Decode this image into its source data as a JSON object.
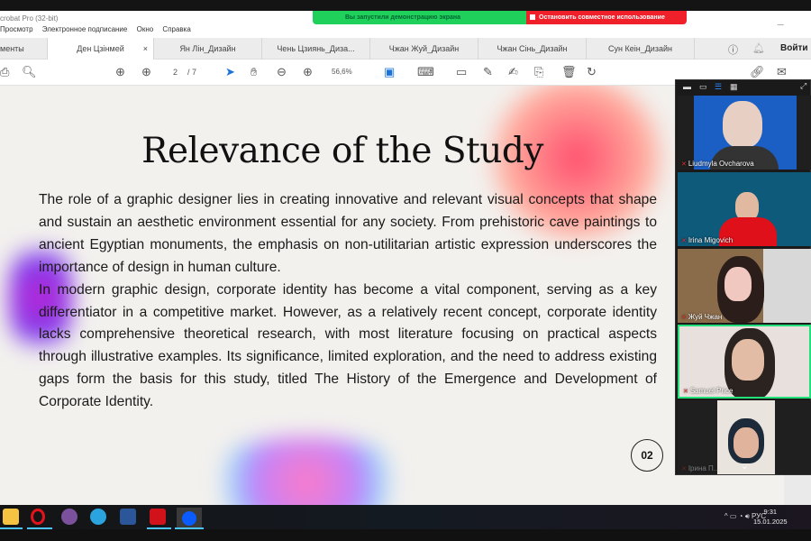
{
  "window": {
    "title": "crobat Pro (32-bit)",
    "share_banner": "Вы запустили демонстрацию экрана",
    "stop_share": "Остановить совместное использование"
  },
  "menu": [
    "Просмотр",
    "Электронное подписание",
    "Окно",
    "Справка"
  ],
  "tabs": [
    {
      "label": "менты"
    },
    {
      "label": "Ден Цзінмей",
      "close": "×"
    },
    {
      "label": "Ян Лін_Дизайн"
    },
    {
      "label": "Чень Цзиянь_Диза..."
    },
    {
      "label": "Чжан Жуй_Дизайн"
    },
    {
      "label": "Чжан Сінь_Дизайн"
    },
    {
      "label": "Сун Кеін_Дизайн"
    }
  ],
  "signin": "Войти",
  "toolbar": {
    "page_current": "2",
    "page_total": "/ 7",
    "zoom": "56,6%"
  },
  "slide": {
    "title": "Relevance of the Study",
    "paragraphs": [
      "The role of a graphic designer lies in creating innovative and relevant visual concepts that shape and sustain an aesthetic environment essential for any society. From prehistoric cave paintings to ancient Egyptian monuments, the emphasis on non-utilitarian artistic expression underscores the importance of design in human culture.",
      "In modern graphic design, corporate identity has become a vital component, serving as a key differentiator in a competitive market. However, as a relatively recent concept, corporate identity lacks comprehensive theoretical research, with most literature focusing on practical aspects through illustrative examples. Its significance, limited exploration, and the need to address existing gaps form the basis for this study, titled The History of the Emergence and Development of Corporate Identity."
    ],
    "page_number": "02"
  },
  "participants": [
    {
      "name": "Liudmyla Ovcharova"
    },
    {
      "name": "Irina Migovich"
    },
    {
      "name": "Жуй Чжан"
    },
    {
      "name": "Samuel Price"
    },
    {
      "name": "Ірина П..."
    }
  ],
  "taskbar": {
    "lang": "РУС",
    "time": "9:31",
    "date": "15.01.2025"
  }
}
